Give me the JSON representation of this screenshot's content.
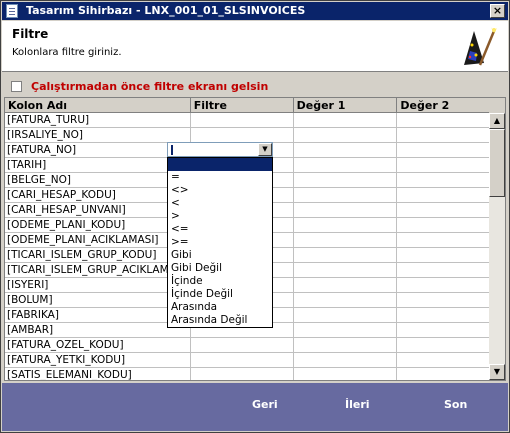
{
  "window": {
    "title": "Tasarım Sihirbazı - LNX_001_01_SLSINVOICES",
    "close_glyph": "×"
  },
  "header": {
    "title": "Filtre",
    "subtitle": "Kolonlara filtre giriniz.",
    "icon": "wizard-hat-icon"
  },
  "option": {
    "label": "Çalıştırmadan önce filtre ekranı gelsin",
    "checked": false
  },
  "grid": {
    "columns": [
      "Kolon Adı",
      "Filtre",
      "Değer 1",
      "Değer 2"
    ],
    "rows": [
      "[FATURA_TURU]",
      "[IRSALIYE_NO]",
      "[FATURA_NO]",
      "[TARIH]",
      "[BELGE_NO]",
      "[CARI_HESAP_KODU]",
      "[CARI_HESAP_UNVANI]",
      "[ODEME_PLANI_KODU]",
      "[ODEME_PLANI_ACIKLAMASI]",
      "[TICARI_ISLEM_GRUP_KODU]",
      "[TICARI_ISLEM_GRUP_ACIKLAMASI]",
      "[ISYERI]",
      "[BOLUM]",
      "[FABRIKA]",
      "[AMBAR]",
      "[FATURA_OZEL_KODU]",
      "[FATURA_YETKI_KODU]",
      "[SATIS_ELEMANI_KODU]"
    ]
  },
  "filter_dropdown": {
    "options": [
      "",
      "=",
      "<>",
      "<",
      ">",
      "<=",
      ">=",
      "Gibi",
      "Gibi Değil",
      "İçinde",
      "İçinde Değil",
      "Arasında",
      "Arasında Değil"
    ],
    "selected_index": 0
  },
  "footer": {
    "back": "Geri",
    "next": "İleri",
    "finish": "Son"
  },
  "colors": {
    "title_bar": "#0a246a",
    "footer": "#676aa0",
    "option_label": "#c00000",
    "selection": "#0a246a"
  }
}
